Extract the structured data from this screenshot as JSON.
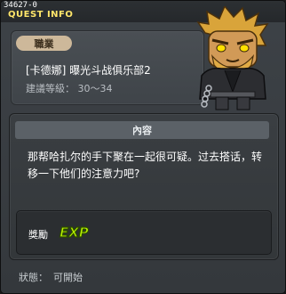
{
  "window": {
    "quest_id": "34627-0",
    "title": "QUEST INFO"
  },
  "info": {
    "job_label": "職業",
    "quest_name": "[卡德娜] 曝光斗战俱乐部2",
    "level_text": "建議等級： 30～34"
  },
  "content": {
    "header": "內容",
    "text": "那帮哈扎尔的手下聚在一起很可疑。过去搭话，转移一下他们的注意力吧?"
  },
  "reward": {
    "label": "獎勵",
    "exp_text": "EXP",
    "icon": "exp-icon"
  },
  "status": {
    "label": "狀態：",
    "value": "可開始"
  },
  "npc": {
    "icon": "npc-portrait"
  },
  "colors": {
    "title": "#ffe66a",
    "badge": "#cdb89a",
    "exp": "#b9f200"
  }
}
